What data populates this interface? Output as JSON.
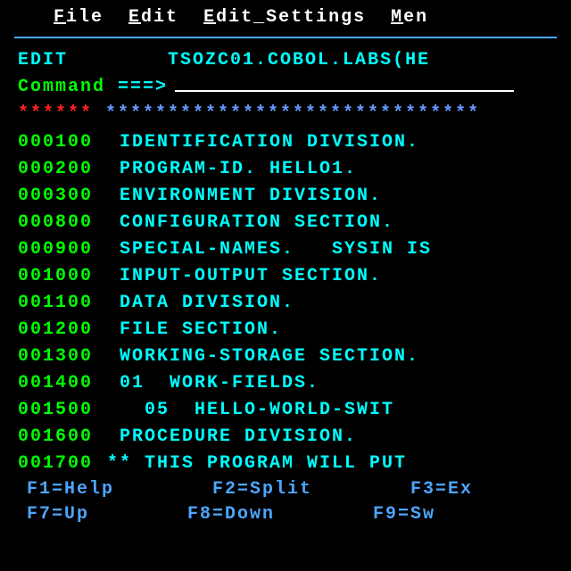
{
  "menu": {
    "file": "File",
    "edit": "Edit",
    "edit_settings": "Edit_Settings",
    "men": "Men"
  },
  "header": {
    "mode": "EDIT",
    "dataset": "TSOZC01.COBOL.LABS(HE"
  },
  "command": {
    "label": "Command",
    "arrow": "===>"
  },
  "top_marker": {
    "stars_red": "******",
    "stars_blue": " ******************************"
  },
  "lines": [
    {
      "num": "000100",
      "text": " IDENTIFICATION DIVISION."
    },
    {
      "num": "000200",
      "text": " PROGRAM-ID. HELLO1."
    },
    {
      "num": "000300",
      "text": " ENVIRONMENT DIVISION."
    },
    {
      "num": "000800",
      "text": " CONFIGURATION SECTION."
    },
    {
      "num": "000900",
      "text": " SPECIAL-NAMES.   SYSIN IS"
    },
    {
      "num": "001000",
      "text": " INPUT-OUTPUT SECTION."
    },
    {
      "num": "001100",
      "text": " DATA DIVISION."
    },
    {
      "num": "001200",
      "text": " FILE SECTION."
    },
    {
      "num": "001300",
      "text": " WORKING-STORAGE SECTION."
    },
    {
      "num": "001400",
      "text": " 01  WORK-FIELDS."
    },
    {
      "num": "001500",
      "text": "   05  HELLO-WORLD-SWIT"
    },
    {
      "num": "001600",
      "text": " PROCEDURE DIVISION."
    },
    {
      "num": "001700",
      "text": "** THIS PROGRAM WILL PUT "
    }
  ],
  "fkeys": {
    "f1": "F1=Help",
    "f2": "F2=Split",
    "f3": "F3=Ex",
    "f7": "F7=Up",
    "f8": "F8=Down",
    "f9": "F9=Sw"
  }
}
